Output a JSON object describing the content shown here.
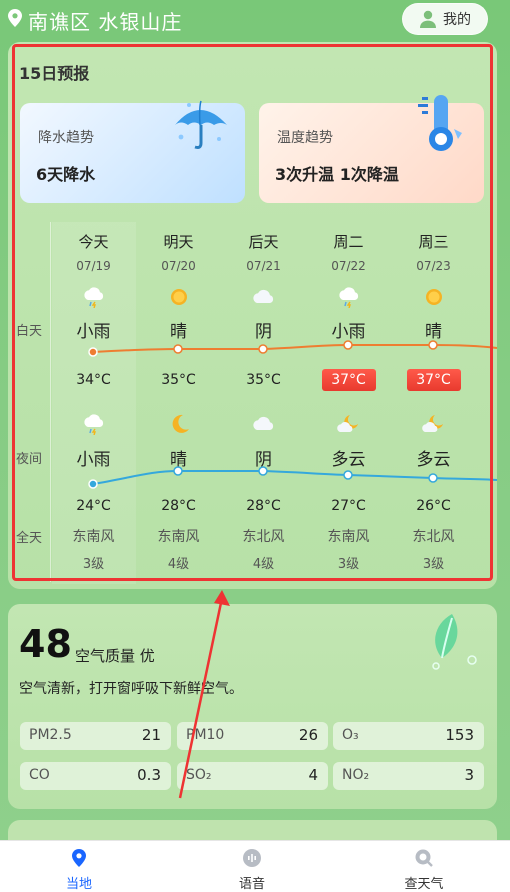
{
  "header": {
    "location": "南谯区 水银山庄",
    "me_label": "我的"
  },
  "forecast": {
    "title": "15日预报",
    "rain_trend": {
      "label": "降水趋势",
      "value": "6天降水"
    },
    "temp_trend": {
      "label": "温度趋势",
      "value": "3次升温 1次降温"
    },
    "row_labels": {
      "day": "白天",
      "night": "夜间",
      "all": "全天"
    },
    "days": [
      {
        "name": "今天",
        "date": "07/19",
        "day_weather": "小雨",
        "day_icon": "light-rain-icon",
        "high": "34°C",
        "hot": false,
        "night_weather": "小雨",
        "night_icon": "light-rain-icon",
        "low": "24°C",
        "wind": "东南风",
        "level": "3级"
      },
      {
        "name": "明天",
        "date": "07/20",
        "day_weather": "晴",
        "day_icon": "sun-icon",
        "high": "35°C",
        "hot": false,
        "night_weather": "晴",
        "night_icon": "moon-icon",
        "low": "28°C",
        "wind": "东南风",
        "level": "4级"
      },
      {
        "name": "后天",
        "date": "07/21",
        "day_weather": "阴",
        "day_icon": "overcast-icon",
        "high": "35°C",
        "hot": false,
        "night_weather": "阴",
        "night_icon": "overcast-icon",
        "low": "28°C",
        "wind": "东北风",
        "level": "4级"
      },
      {
        "name": "周二",
        "date": "07/22",
        "day_weather": "小雨",
        "day_icon": "light-rain-icon",
        "high": "37°C",
        "hot": true,
        "night_weather": "多云",
        "night_icon": "partly-cloudy-night-icon",
        "low": "27°C",
        "wind": "东南风",
        "level": "3级"
      },
      {
        "name": "周三",
        "date": "07/23",
        "day_weather": "晴",
        "day_icon": "sun-icon",
        "high": "37°C",
        "hot": true,
        "night_weather": "多云",
        "night_icon": "partly-cloudy-night-icon",
        "low": "26°C",
        "wind": "东北风",
        "level": "3级"
      }
    ],
    "colors": {
      "high_line": "#ee7d31",
      "low_line": "#35a8dc",
      "hot_badge": "#e83a2e"
    }
  },
  "air_quality": {
    "aqi": "48",
    "label": "空气质量 优",
    "description": "空气清新，打开窗呼吸下新鲜空气。",
    "pollutants": [
      {
        "name": "PM2.5",
        "value": "21"
      },
      {
        "name": "PM10",
        "value": "26"
      },
      {
        "name": "O₃",
        "value": "153"
      },
      {
        "name": "CO",
        "value": "0.3"
      },
      {
        "name": "SO₂",
        "value": "4"
      },
      {
        "name": "NO₂",
        "value": "3"
      }
    ]
  },
  "bottom_nav": [
    {
      "label": "当地",
      "icon": "location-icon",
      "active": true
    },
    {
      "label": "语音",
      "icon": "voice-icon",
      "active": false
    },
    {
      "label": "查天气",
      "icon": "search-weather-icon",
      "active": false
    }
  ]
}
